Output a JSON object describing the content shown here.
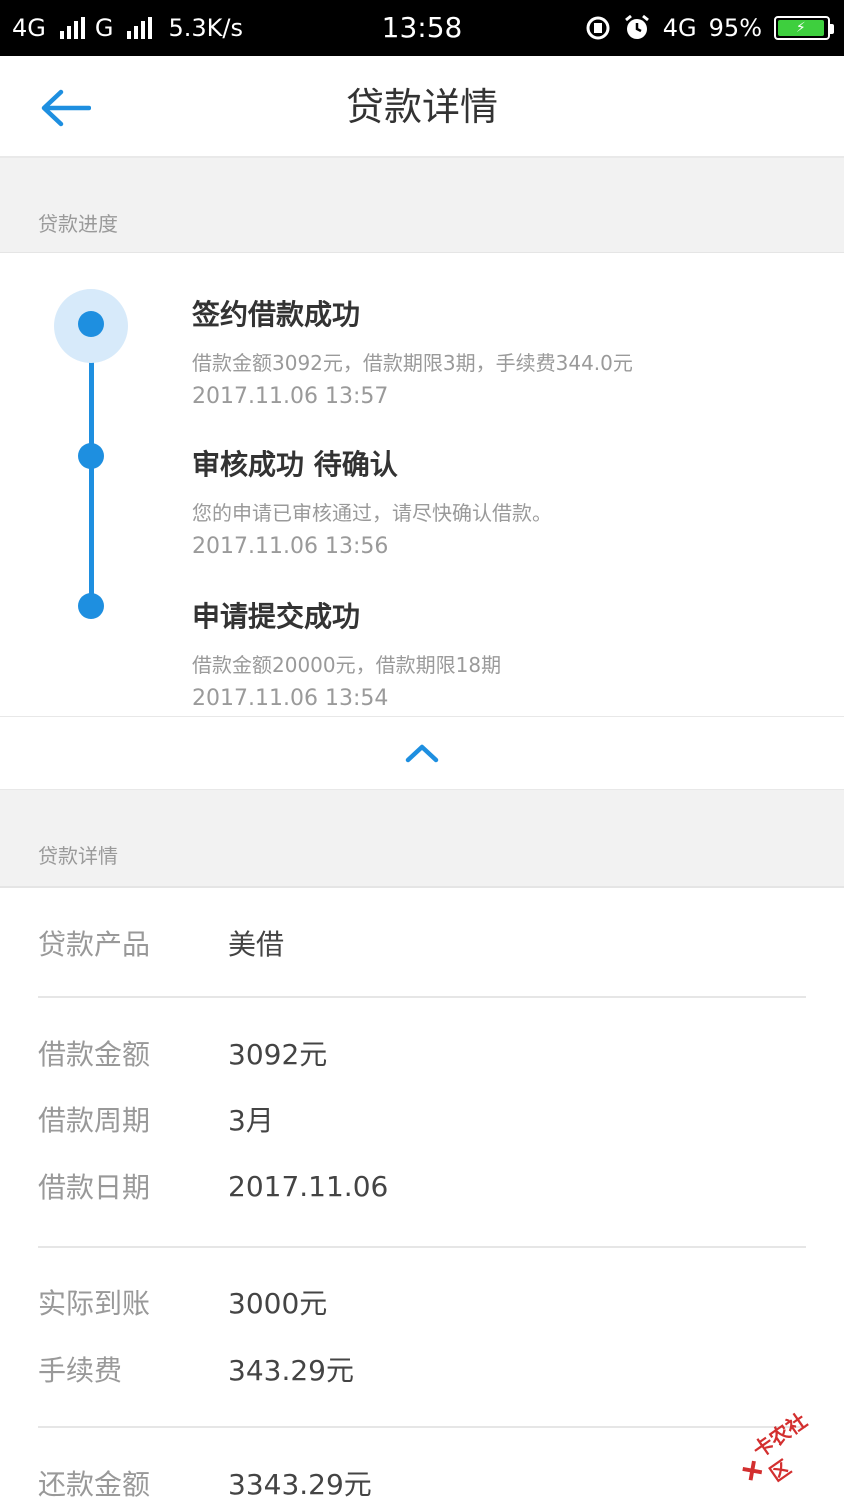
{
  "status_bar": {
    "net1": "4G",
    "net2": "G",
    "speed": "5.3K/s",
    "time": "13:58",
    "net3": "4G",
    "battery": "95%",
    "battery_level": 95
  },
  "header": {
    "title": "贷款详情"
  },
  "progress_section": {
    "label": "贷款进度",
    "steps": [
      {
        "title": "签约借款成功",
        "desc": "借款金额3092元，借款期限3期，手续费344.0元",
        "time": "2017.11.06 13:57"
      },
      {
        "title": "审核成功 待确认",
        "desc": "您的申请已审核通过，请尽快确认借款。",
        "time": "2017.11.06 13:56"
      },
      {
        "title": "申请提交成功",
        "desc": "借款金额20000元，借款期限18期",
        "time": "2017.11.06 13:54"
      }
    ]
  },
  "details_section": {
    "label": "贷款详情",
    "rows": [
      {
        "label": "贷款产品",
        "value": "美借"
      },
      {
        "label": "借款金额",
        "value": "3092元"
      },
      {
        "label": "借款周期",
        "value": "3月"
      },
      {
        "label": "借款日期",
        "value": "2017.11.06"
      },
      {
        "label": "实际到账",
        "value": "3000元"
      },
      {
        "label": "手续费",
        "value": "343.29元"
      },
      {
        "label": "还款金额",
        "value": "3343.29元"
      }
    ]
  },
  "watermark": {
    "text": "卡农社区"
  },
  "colors": {
    "accent": "#1e8fe0",
    "halo": "#d7eafa",
    "label_gray": "#999999"
  }
}
